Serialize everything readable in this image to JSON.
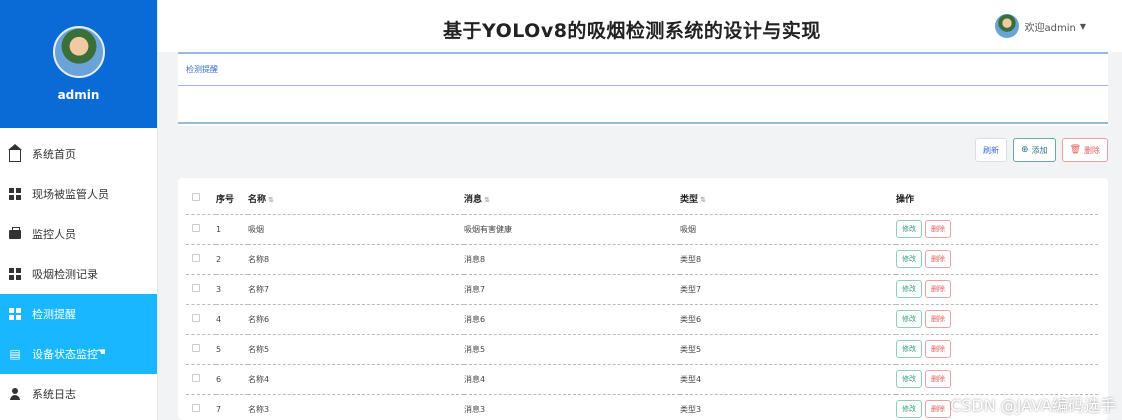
{
  "sidebar": {
    "user_name": "admin",
    "menu": [
      {
        "label": "系统首页",
        "icon": "home-icon",
        "state": "normal"
      },
      {
        "label": "现场被监管人员",
        "icon": "grid-icon",
        "state": "normal"
      },
      {
        "label": "监控人员",
        "icon": "briefcase-icon",
        "state": "normal"
      },
      {
        "label": "吸烟检测记录",
        "icon": "grid-icon",
        "state": "normal"
      },
      {
        "label": "检测提醒",
        "icon": "grid-icon",
        "state": "active"
      },
      {
        "label": "设备状态监控",
        "icon": "clipboard-icon",
        "state": "hover"
      },
      {
        "label": "系统日志",
        "icon": "user-icon",
        "state": "normal"
      }
    ]
  },
  "header": {
    "title": "基于YOLOv8的吸烟检测系统的设计与实现",
    "welcome": "欢迎admin"
  },
  "breadcrumb": "检测提醒",
  "toolbar": {
    "refresh": "刷新",
    "add": "添加",
    "delete": "删除"
  },
  "table": {
    "headers": {
      "no": "序号",
      "name": "名称",
      "msg": "消息",
      "type": "类型",
      "ops": "操作"
    },
    "edit_label": "修改",
    "delete_label": "删除",
    "rows": [
      {
        "no": "1",
        "name": "吸烟",
        "msg": "吸烟有害健康",
        "type": "吸烟"
      },
      {
        "no": "2",
        "name": "名称8",
        "msg": "消息8",
        "type": "类型8"
      },
      {
        "no": "3",
        "name": "名称7",
        "msg": "消息7",
        "type": "类型7"
      },
      {
        "no": "4",
        "name": "名称6",
        "msg": "消息6",
        "type": "类型6"
      },
      {
        "no": "5",
        "name": "名称5",
        "msg": "消息5",
        "type": "类型5"
      },
      {
        "no": "6",
        "name": "名称4",
        "msg": "消息4",
        "type": "类型4"
      },
      {
        "no": "7",
        "name": "名称3",
        "msg": "消息3",
        "type": "类型3"
      }
    ]
  },
  "watermark": "CSDN @JAVA编码选手",
  "colors": {
    "sidebar_head": "#0a6ad6",
    "active_menu": "#18b7ff"
  }
}
